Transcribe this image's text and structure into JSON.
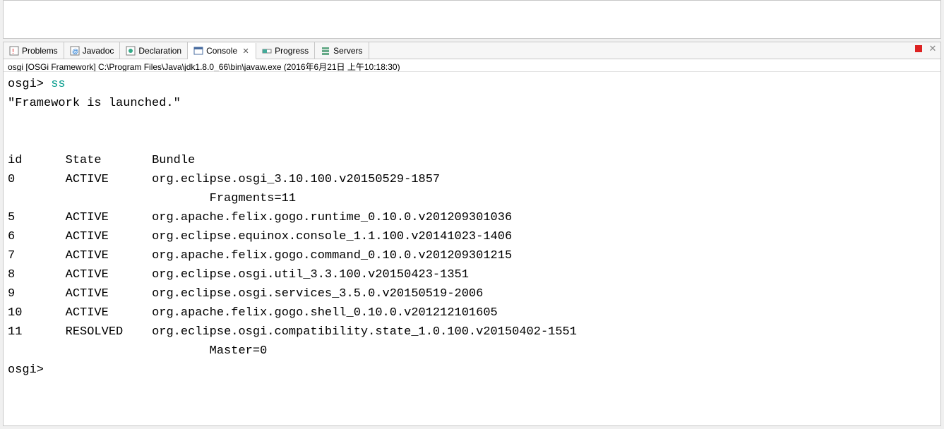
{
  "tabs": [
    {
      "label": "Problems",
      "icon": "problems-icon"
    },
    {
      "label": "Javadoc",
      "icon": "javadoc-icon"
    },
    {
      "label": "Declaration",
      "icon": "declaration-icon"
    },
    {
      "label": "Console",
      "icon": "console-icon",
      "active": true,
      "closable": true
    },
    {
      "label": "Progress",
      "icon": "progress-icon"
    },
    {
      "label": "Servers",
      "icon": "servers-icon"
    }
  ],
  "breadcrumb": "osgi [OSGi Framework] C:\\Program Files\\Java\\jdk1.8.0_66\\bin\\javaw.exe (2016年6月21日 上午10:18:30)",
  "console": {
    "prompt": "osgi>",
    "command": "ss",
    "status_line": "\"Framework is launched.\"",
    "header": {
      "id": "id",
      "state": "State",
      "bundle": "Bundle"
    },
    "rows": [
      {
        "id": "0",
        "state": "ACTIVE",
        "bundle": "org.eclipse.osgi_3.10.100.v20150529-1857",
        "extra": "Fragments=11"
      },
      {
        "id": "5",
        "state": "ACTIVE",
        "bundle": "org.apache.felix.gogo.runtime_0.10.0.v201209301036"
      },
      {
        "id": "6",
        "state": "ACTIVE",
        "bundle": "org.eclipse.equinox.console_1.1.100.v20141023-1406"
      },
      {
        "id": "7",
        "state": "ACTIVE",
        "bundle": "org.apache.felix.gogo.command_0.10.0.v201209301215"
      },
      {
        "id": "8",
        "state": "ACTIVE",
        "bundle": "org.eclipse.osgi.util_3.3.100.v20150423-1351"
      },
      {
        "id": "9",
        "state": "ACTIVE",
        "bundle": "org.eclipse.osgi.services_3.5.0.v20150519-2006"
      },
      {
        "id": "10",
        "state": "ACTIVE",
        "bundle": "org.apache.felix.gogo.shell_0.10.0.v201212101605"
      },
      {
        "id": "11",
        "state": "RESOLVED",
        "bundle": "org.eclipse.osgi.compatibility.state_1.0.100.v20150402-1551",
        "extra": "Master=0"
      }
    ],
    "prompt2": "osgi>"
  }
}
